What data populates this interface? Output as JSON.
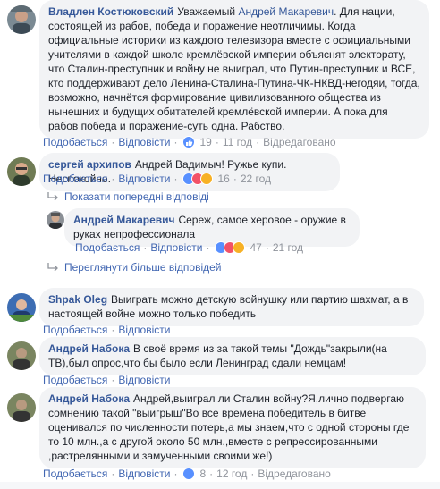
{
  "comments": [
    {
      "author": "Владлен Костюковский",
      "text_before": "Уважаемый ",
      "mention": "Андрей Макаревич",
      "text_after": ". Для нации, состоящей из рабов, победа и поражение неотличимы. Когда официальные историки из каждого телевизора вместе с официальными учителями в каждой школе кремлёвской империи объяснят электорату, что Сталин-преступник и войну не выиграл, что Путин-преступник и ВСЕ, кто поддерживают дело Ленина-Сталина-Путина-ЧК-НКВД-негодяи, тогда, возможно, начнётся формирование цивилизованного общества из нынешних и будущих обитателей кремлёвской империи. А пока для рабов победа и поражение-суть одна. Рабство.",
      "like": "Подобається",
      "reply": "Відповісти",
      "count": "19",
      "time": "11 год",
      "edited": "Відредаговано"
    },
    {
      "author": "сергей архипов",
      "text": "Андрей Вадимыч! Ружье купи. Неспокойно.",
      "like": "Подобається",
      "reply": "Відповісти",
      "count": "16",
      "time": "22 год"
    },
    {
      "author": "Андрей Макаревич",
      "text": "Сереж, самое херовое - оружие в руках непрофессионала",
      "like": "Подобається",
      "reply": "Відповісти",
      "count": "47",
      "time": "21 год"
    },
    {
      "author": "Shpak Oleg",
      "text": "Выиграть можно детскую войнушку или партию шахмат, а в настоящей войне можно только победить",
      "like": "Подобається",
      "reply": "Відповісти"
    },
    {
      "author": "Андрей Набока",
      "text": "В своё время из за такой темы \"Дождь\"закрыли(на ТВ),был опрос,что бы было если Ленинград сдали немцам!",
      "like": "Подобається",
      "reply": "Відповісти"
    },
    {
      "author": "Андрей Набока",
      "text": "Андрей,выиграл ли Сталин войну?Я,лично подвергаю сомнению такой \"выигрыш\"Во все времена победитель в битве оценивался по численности потерь,а мы знаем,что с одной стороны где то 10 млн.,а с другой около 50 млн.,вместе с репрессированными ,растрелянными и замученными своими же!)",
      "like": "Подобається",
      "reply": "Відповісти",
      "count": "8",
      "time": "12 год",
      "edited": "Відредаговано"
    }
  ],
  "show_previous": "Показати попередні відповіді",
  "show_more": "Переглянути більше відповідей",
  "colors": {
    "link": "#4267b2",
    "name": "#365899",
    "meta": "#90949c",
    "bubble": "#f2f3f5",
    "like": "#5890ff",
    "love": "#f25268",
    "haha": "#f7b125"
  },
  "icons": [
    "like-reaction-icon",
    "love-reaction-icon",
    "haha-reaction-icon",
    "reply-arrow-icon"
  ]
}
